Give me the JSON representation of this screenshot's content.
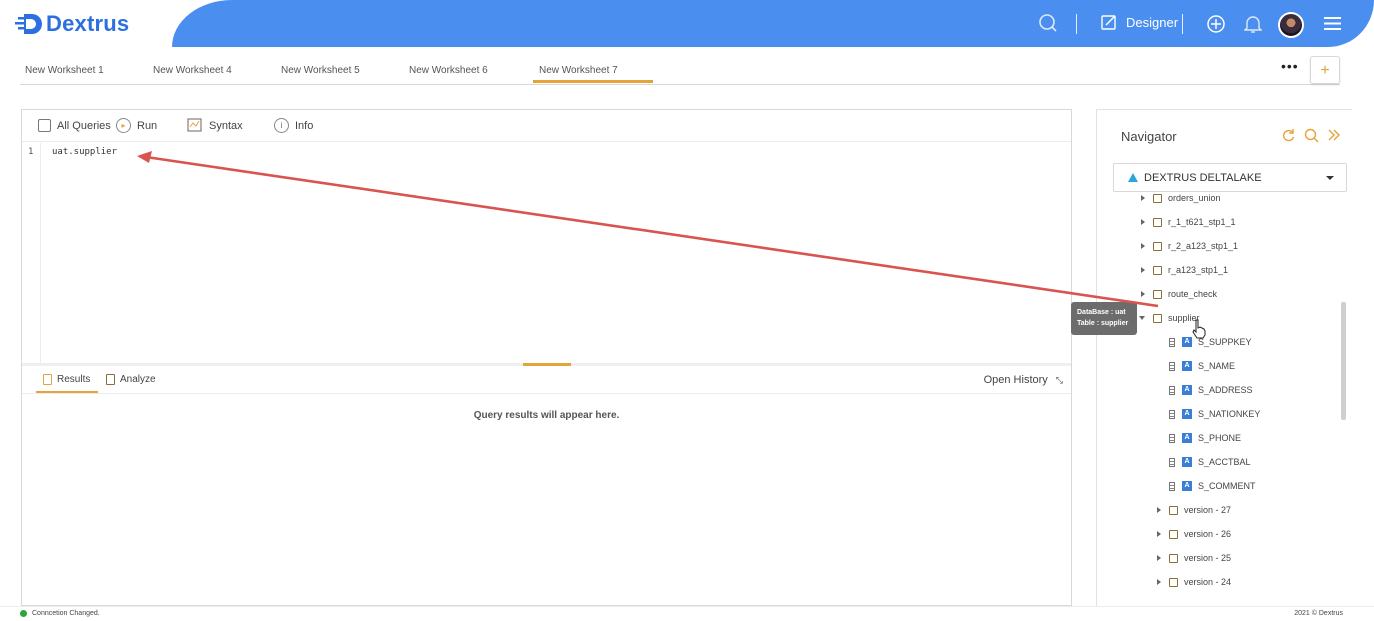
{
  "app": {
    "name": "Dextrus"
  },
  "header": {
    "mode_label": "Designer"
  },
  "tabs": [
    {
      "label": "New Worksheet 1"
    },
    {
      "label": "New Worksheet 4"
    },
    {
      "label": "New Worksheet 5"
    },
    {
      "label": "New Worksheet 6"
    },
    {
      "label": "New Worksheet 7",
      "active": true
    }
  ],
  "toolbar": {
    "all_queries_label": "All Queries",
    "run_label": "Run",
    "syntax_label": "Syntax",
    "info_label": "Info"
  },
  "editor": {
    "line_number": "1",
    "code": "uat.supplier"
  },
  "results": {
    "results_tab": "Results",
    "analyze_tab": "Analyze",
    "open_history_label": "Open History",
    "empty_message": "Query results will appear here."
  },
  "navigator": {
    "title": "Navigator",
    "database": "DEXTRUS DELTALAKE",
    "tree": {
      "partial_top": "orders_union",
      "tables": [
        "r_1_t621_stp1_1",
        "r_2_a123_stp1_1",
        "r_a123_stp1_1",
        "route_check",
        "supplier"
      ],
      "columns": [
        "S_SUPPKEY",
        "S_NAME",
        "S_ADDRESS",
        "S_NATIONKEY",
        "S_PHONE",
        "S_ACCTBAL",
        "S_COMMENT"
      ],
      "versions": [
        "version - 27",
        "version - 26",
        "version - 25",
        "version - 24"
      ]
    }
  },
  "tooltip": {
    "database_line": "DataBase : uat",
    "table_line": "Table : supplier"
  },
  "footer": {
    "status": "Conncetion Changed.",
    "copyright": "2021 © Dextrus"
  },
  "colors": {
    "header_blue": "#4a8ef0",
    "accent_orange": "#e6a33a",
    "arrow_red": "#d9534f",
    "status_green": "#2aa63a"
  }
}
